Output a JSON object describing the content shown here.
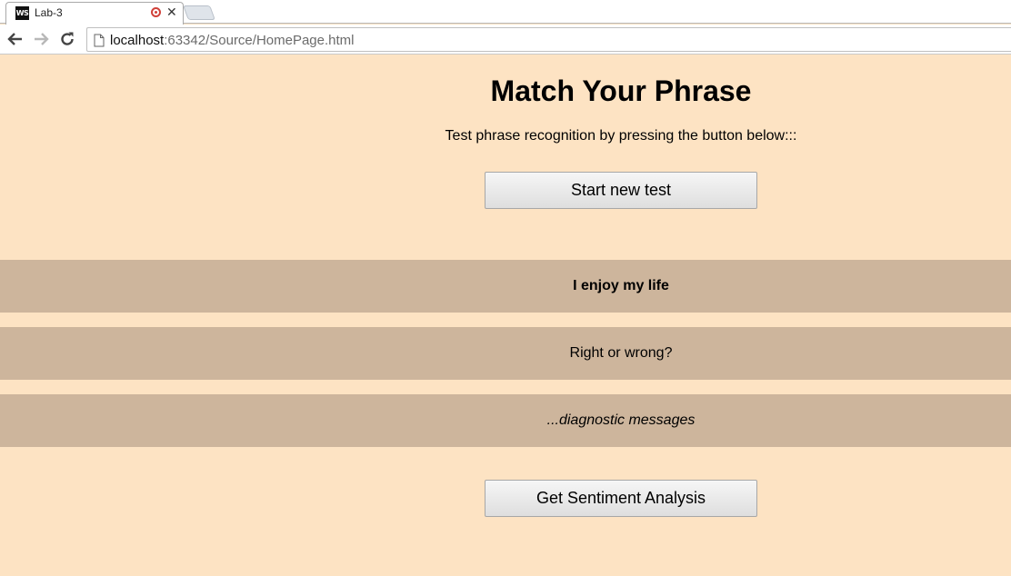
{
  "browser": {
    "tab": {
      "favicon_text": "WS",
      "title": "Lab-3"
    },
    "address": {
      "host": "localhost",
      "rest": ":63342/Source/HomePage.html"
    }
  },
  "page": {
    "title": "Match Your Phrase",
    "subtitle": "Test phrase recognition by pressing the button below:::",
    "start_button": "Start new test",
    "phrase": "I enjoy my life",
    "result": "Right or wrong?",
    "diagnostics": "...diagnostic messages",
    "sentiment_button": "Get Sentiment Analysis"
  },
  "colors": {
    "page_background": "#fde3c3",
    "band_background": "#cdb59c"
  }
}
